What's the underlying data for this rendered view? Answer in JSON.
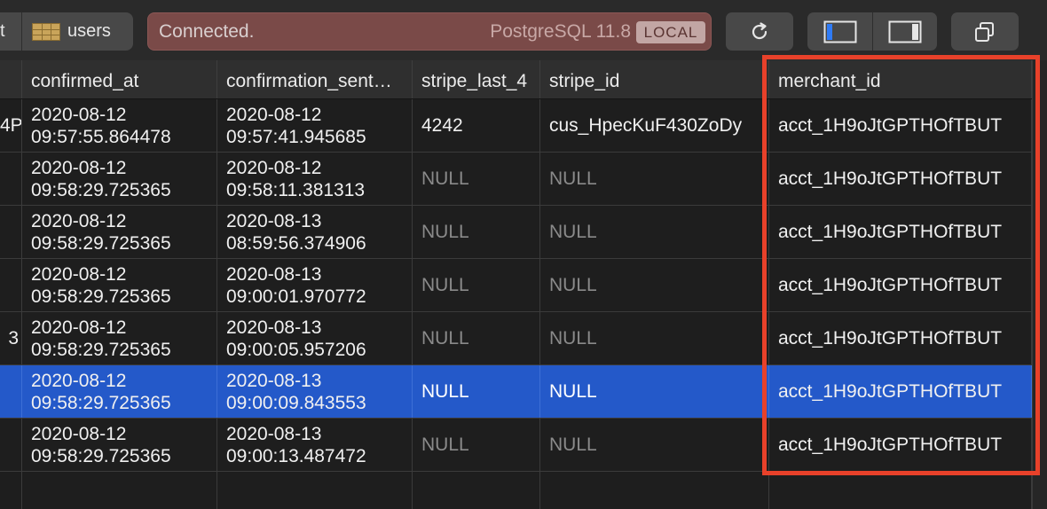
{
  "breadcrumb": {
    "truncated_text": "t",
    "table_name": "users"
  },
  "status": {
    "message": "Connected.",
    "db_version": "PostgreSQL 11.8",
    "badge": "LOCAL"
  },
  "toolbar": {
    "refresh_icon": "refresh-icon",
    "left_panel_icon": "sidebar-left-icon",
    "right_panel_icon": "sidebar-right-icon",
    "copy_icon": "duplicate-window-icon"
  },
  "columns": [
    "confirmed_at",
    "confirmation_sent…",
    "stripe_last_4",
    "stripe_id",
    "merchant_id"
  ],
  "rows": [
    {
      "partial": "4P",
      "confirmed_at": [
        "2020-08-12",
        "09:57:55.864478"
      ],
      "confirmation_sent": [
        "2020-08-12",
        "09:57:41.945685"
      ],
      "stripe_last_4": "4242",
      "stripe_id": "cus_HpecKuF430ZoDy",
      "merchant_id": "acct_1H9oJtGPTHOfTBUT",
      "selected": false
    },
    {
      "partial": "",
      "confirmed_at": [
        "2020-08-12",
        "09:58:29.725365"
      ],
      "confirmation_sent": [
        "2020-08-12",
        "09:58:11.381313"
      ],
      "stripe_last_4": "NULL",
      "stripe_id": "NULL",
      "merchant_id": "acct_1H9oJtGPTHOfTBUT",
      "selected": false
    },
    {
      "partial": "",
      "confirmed_at": [
        "2020-08-12",
        "09:58:29.725365"
      ],
      "confirmation_sent": [
        "2020-08-13",
        "08:59:56.374906"
      ],
      "stripe_last_4": "NULL",
      "stripe_id": "NULL",
      "merchant_id": "acct_1H9oJtGPTHOfTBUT",
      "selected": false
    },
    {
      "partial": "",
      "confirmed_at": [
        "2020-08-12",
        "09:58:29.725365"
      ],
      "confirmation_sent": [
        "2020-08-13",
        "09:00:01.970772"
      ],
      "stripe_last_4": "NULL",
      "stripe_id": "NULL",
      "merchant_id": "acct_1H9oJtGPTHOfTBUT",
      "selected": false
    },
    {
      "partial": "3",
      "confirmed_at": [
        "2020-08-12",
        "09:58:29.725365"
      ],
      "confirmation_sent": [
        "2020-08-13",
        "09:00:05.957206"
      ],
      "stripe_last_4": "NULL",
      "stripe_id": "NULL",
      "merchant_id": "acct_1H9oJtGPTHOfTBUT",
      "selected": false
    },
    {
      "partial": "",
      "confirmed_at": [
        "2020-08-12",
        "09:58:29.725365"
      ],
      "confirmation_sent": [
        "2020-08-13",
        "09:00:09.843553"
      ],
      "stripe_last_4": "NULL",
      "stripe_id": "NULL",
      "merchant_id": "acct_1H9oJtGPTHOfTBUT",
      "selected": true
    },
    {
      "partial": "",
      "confirmed_at": [
        "2020-08-12",
        "09:58:29.725365"
      ],
      "confirmation_sent": [
        "2020-08-13",
        "09:00:13.487472"
      ],
      "stripe_last_4": "NULL",
      "stripe_id": "NULL",
      "merchant_id": "acct_1H9oJtGPTHOfTBUT",
      "selected": false
    }
  ],
  "colors": {
    "selection": "#2459c9",
    "annotation_border": "#e8412a",
    "status_bg": "#7a4a48"
  }
}
